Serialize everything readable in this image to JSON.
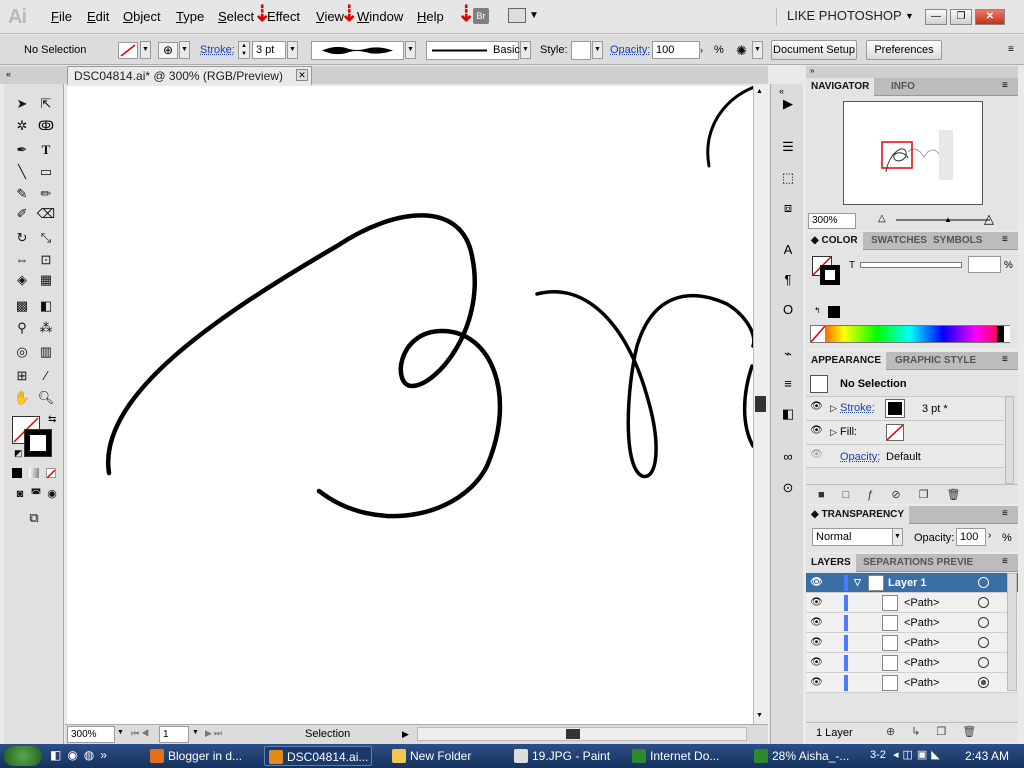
{
  "app": {
    "logo": "Ai",
    "bridge_badge": "Br",
    "workspace": "LIKE PHOTOSHOP"
  },
  "menu": [
    {
      "label": "File",
      "u": "F",
      "rest": "ile"
    },
    {
      "label": "Edit",
      "u": "E",
      "rest": "dit"
    },
    {
      "label": "Object",
      "u": "O",
      "rest": "bject"
    },
    {
      "label": "Type",
      "u": "T",
      "rest": "ype"
    },
    {
      "label": "Select",
      "u": "S",
      "rest": "elect"
    },
    {
      "label": "Effect",
      "u": "C",
      "rest": "Effect"
    },
    {
      "label": "View",
      "u": "V",
      "rest": "iew"
    },
    {
      "label": "Window",
      "u": "W",
      "rest": "indow"
    },
    {
      "label": "Help",
      "u": "H",
      "rest": "elp"
    }
  ],
  "control": {
    "selection": "No Selection",
    "stroke_label": "Stroke:",
    "stroke_value": "3 pt",
    "brush_name": "Basic",
    "style_label": "Style:",
    "opacity_label": "Opacity:",
    "opacity_value": "100",
    "opacity_unit": "%",
    "doc_setup": "Document Setup",
    "preferences": "Preferences"
  },
  "document": {
    "tab": "DSC04814.ai* @ 300% (RGB/Preview)",
    "close": "✕"
  },
  "status": {
    "zoom": "300%",
    "page": "1",
    "tool": "Selection"
  },
  "navigator": {
    "tabs": [
      "NAVIGATOR",
      "INFO"
    ],
    "zoom": "300%"
  },
  "color": {
    "tabs": [
      "COLOR",
      "SWATCHES",
      "SYMBOLS"
    ],
    "t_label": "T",
    "pct": "%"
  },
  "appearance": {
    "tabs": [
      "APPEARANCE",
      "GRAPHIC STYLE"
    ],
    "title": "No Selection",
    "stroke_label": "Stroke:",
    "stroke_value": "3 pt *",
    "fill_label": "Fill:",
    "opacity_label": "Opacity:",
    "opacity_value": "Default"
  },
  "transparency": {
    "tab": "TRANSPARENCY",
    "mode": "Normal",
    "opacity_label": "Opacity:",
    "opacity_value": "100",
    "pct": "%"
  },
  "layers": {
    "tabs": [
      "LAYERS",
      "SEPARATIONS PREVIE"
    ],
    "layer_name": "Layer 1",
    "paths": [
      "<Path>",
      "<Path>",
      "<Path>",
      "<Path>",
      "<Path>"
    ],
    "count": "1 Layer"
  },
  "taskbar": {
    "items": [
      "Blogger in d...",
      "DSC04814.ai...",
      "New Folder",
      "19.JPG - Paint",
      "Internet Do...",
      "28% Aisha_-..."
    ],
    "page_indicator": "3-2",
    "clock": "2:43 AM"
  },
  "colors": {
    "accent_red": "#e00000",
    "layer_blue": "#3a6ea5",
    "taskbar": "#1f3d72"
  }
}
